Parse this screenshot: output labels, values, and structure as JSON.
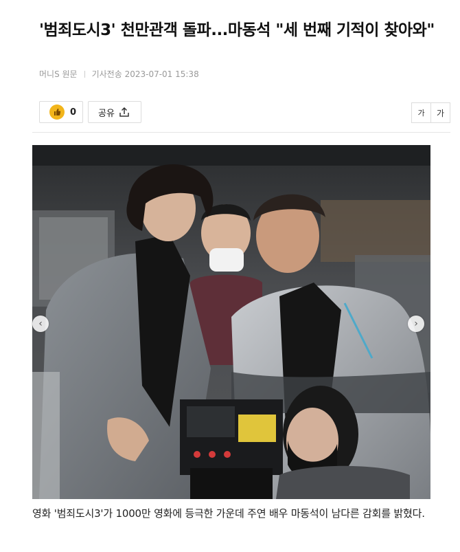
{
  "article": {
    "headline": "'범죄도시3' 천만관객 돌파...마동석 \"세 번째 기적이 찾아와\"",
    "source": "머니S 원문",
    "published": "기사전송 2023-07-01 15:38",
    "body": "영화 '범죄도시3'가 1000만 영화에 등극한 가운데 주연 배우 마동석이 남다른 감회를 밝혔다."
  },
  "toolbar": {
    "like_count": "0",
    "share_label": "공유",
    "font_small": "가",
    "font_large": "가"
  },
  "icons": {
    "like": "thumbs-up-icon",
    "share": "share-icon",
    "prev": "chevron-left-icon",
    "next": "chevron-right-icon"
  },
  "colors": {
    "like_badge": "#f2b51b",
    "divider": "#e5e5e5",
    "meta_text": "#999999"
  }
}
